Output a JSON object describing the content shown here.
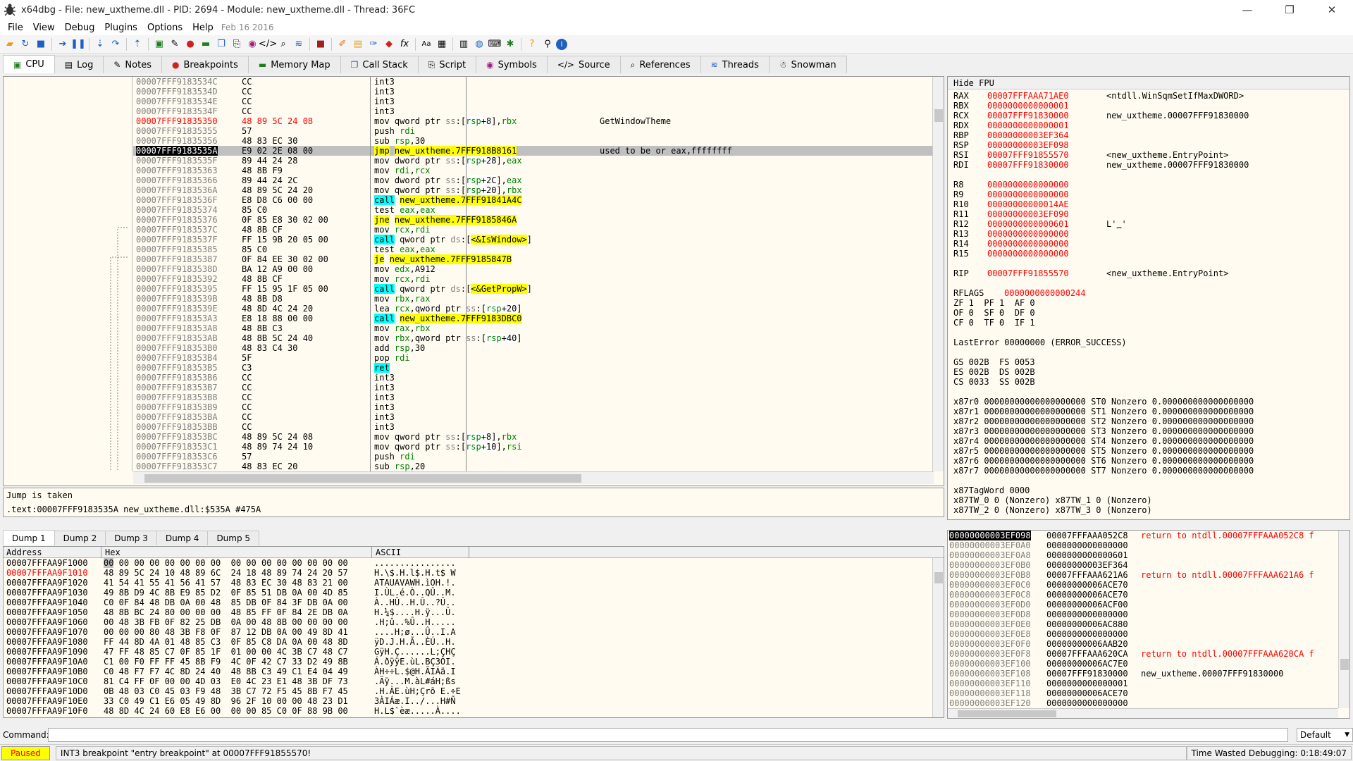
{
  "window": {
    "title": "x64dbg - File: new_uxtheme.dll - PID: 2694 - Module: new_uxtheme.dll - Thread: 36FC",
    "minimize": "—",
    "maximize": "❐",
    "close": "✕"
  },
  "menu": {
    "items": [
      "File",
      "View",
      "Debug",
      "Plugins",
      "Options",
      "Help"
    ],
    "date": "Feb 16 2016"
  },
  "tabs": [
    {
      "label": "CPU",
      "icon": "cpu-icon"
    },
    {
      "label": "Log",
      "icon": "log-icon"
    },
    {
      "label": "Notes",
      "icon": "notes-icon"
    },
    {
      "label": "Breakpoints",
      "icon": "breakpoint-dot-icon"
    },
    {
      "label": "Memory Map",
      "icon": "memory-map-icon"
    },
    {
      "label": "Call Stack",
      "icon": "call-stack-icon"
    },
    {
      "label": "Script",
      "icon": "script-icon"
    },
    {
      "label": "Symbols",
      "icon": "symbols-icon"
    },
    {
      "label": "Source",
      "icon": "source-icon"
    },
    {
      "label": "References",
      "icon": "references-icon"
    },
    {
      "label": "Threads",
      "icon": "threads-icon"
    },
    {
      "label": "Snowman",
      "icon": "snowman-icon"
    }
  ],
  "disasm": [
    {
      "addr": "00007FFF9183534C",
      "bytes": "CC",
      "instr": "int3",
      "cmt": ""
    },
    {
      "addr": "00007FFF9183534D",
      "bytes": "CC",
      "instr": "int3",
      "cmt": ""
    },
    {
      "addr": "00007FFF9183534E",
      "bytes": "CC",
      "instr": "int3",
      "cmt": ""
    },
    {
      "addr": "00007FFF9183534F",
      "bytes": "CC",
      "instr": "int3",
      "cmt": ""
    },
    {
      "addr": "00007FFF91835350",
      "bytes": "48 89 5C 24 08",
      "instr": "mov qword ptr ss:[rsp+8],rbx",
      "cmt": "GetWindowTheme",
      "bp": true
    },
    {
      "addr": "00007FFF91835355",
      "bytes": "57",
      "instr": "push rdi",
      "cmt": ""
    },
    {
      "addr": "00007FFF91835356",
      "bytes": "48 83 EC 30",
      "instr": "sub rsp,30",
      "cmt": ""
    },
    {
      "addr": "00007FFF9183535A",
      "bytes": "E9 02 2E 08 00",
      "instr": "jmp new_uxtheme.7FFF918B8161",
      "cmt": "used to be or eax,ffffffff",
      "cur": true,
      "hl": "jmp"
    },
    {
      "addr": "00007FFF9183535F",
      "bytes": "89 44 24 28",
      "instr": "mov dword ptr ss:[rsp+28],eax",
      "cmt": ""
    },
    {
      "addr": "00007FFF91835363",
      "bytes": "48 8B F9",
      "instr": "mov rdi,rcx",
      "cmt": ""
    },
    {
      "addr": "00007FFF91835366",
      "bytes": "89 44 24 2C",
      "instr": "mov dword ptr ss:[rsp+2C],eax",
      "cmt": ""
    },
    {
      "addr": "00007FFF9183536A",
      "bytes": "48 89 5C 24 20",
      "instr": "mov qword ptr ss:[rsp+20],rbx",
      "cmt": ""
    },
    {
      "addr": "00007FFF9183536F",
      "bytes": "E8 D8 C6 00 00",
      "instr": "call new_uxtheme.7FFF91841A4C",
      "cmt": "",
      "hl": "call"
    },
    {
      "addr": "00007FFF91835374",
      "bytes": "85 C0",
      "instr": "test eax,eax",
      "cmt": ""
    },
    {
      "addr": "00007FFF91835376",
      "bytes": "0F 85 E8 30 02 00",
      "instr": "jne new_uxtheme.7FFF9185846A",
      "cmt": "",
      "hl": "jmp"
    },
    {
      "addr": "00007FFF9183537C",
      "bytes": "48 8B CF",
      "instr": "mov rcx,rdi",
      "cmt": ""
    },
    {
      "addr": "00007FFF9183537F",
      "bytes": "FF 15 9B 20 05 00",
      "instr": "call qword ptr ds:[<&IsWindow>]",
      "cmt": "",
      "hl": "call"
    },
    {
      "addr": "00007FFF91835385",
      "bytes": "85 C0",
      "instr": "test eax,eax",
      "cmt": ""
    },
    {
      "addr": "00007FFF91835387",
      "bytes": "0F 84 EE 30 02 00",
      "instr": "je new_uxtheme.7FFF9185847B",
      "cmt": "",
      "hl": "jmp"
    },
    {
      "addr": "00007FFF9183538D",
      "bytes": "BA 12 A9 00 00",
      "instr": "mov edx,A912",
      "cmt": ""
    },
    {
      "addr": "00007FFF91835392",
      "bytes": "48 8B CF",
      "instr": "mov rcx,rdi",
      "cmt": ""
    },
    {
      "addr": "00007FFF91835395",
      "bytes": "FF 15 95 1F 05 00",
      "instr": "call qword ptr ds:[<&GetPropW>]",
      "cmt": "",
      "hl": "call"
    },
    {
      "addr": "00007FFF9183539B",
      "bytes": "48 8B D8",
      "instr": "mov rbx,rax",
      "cmt": ""
    },
    {
      "addr": "00007FFF9183539E",
      "bytes": "48 8D 4C 24 20",
      "instr": "lea rcx,qword ptr ss:[rsp+20]",
      "cmt": ""
    },
    {
      "addr": "00007FFF918353A3",
      "bytes": "E8 18 88 00 00",
      "instr": "call new_uxtheme.7FFF9183DBC0",
      "cmt": "",
      "hl": "call"
    },
    {
      "addr": "00007FFF918353A8",
      "bytes": "48 8B C3",
      "instr": "mov rax,rbx",
      "cmt": ""
    },
    {
      "addr": "00007FFF918353AB",
      "bytes": "48 8B 5C 24 40",
      "instr": "mov rbx,qword ptr ss:[rsp+40]",
      "cmt": ""
    },
    {
      "addr": "00007FFF918353B0",
      "bytes": "48 83 C4 30",
      "instr": "add rsp,30",
      "cmt": ""
    },
    {
      "addr": "00007FFF918353B4",
      "bytes": "5F",
      "instr": "pop rdi",
      "cmt": ""
    },
    {
      "addr": "00007FFF918353B5",
      "bytes": "C3",
      "instr": "ret",
      "cmt": "",
      "hl": "ret"
    },
    {
      "addr": "00007FFF918353B6",
      "bytes": "CC",
      "instr": "int3",
      "cmt": ""
    },
    {
      "addr": "00007FFF918353B7",
      "bytes": "CC",
      "instr": "int3",
      "cmt": ""
    },
    {
      "addr": "00007FFF918353B8",
      "bytes": "CC",
      "instr": "int3",
      "cmt": ""
    },
    {
      "addr": "00007FFF918353B9",
      "bytes": "CC",
      "instr": "int3",
      "cmt": ""
    },
    {
      "addr": "00007FFF918353BA",
      "bytes": "CC",
      "instr": "int3",
      "cmt": ""
    },
    {
      "addr": "00007FFF918353BB",
      "bytes": "CC",
      "instr": "int3",
      "cmt": ""
    },
    {
      "addr": "00007FFF918353BC",
      "bytes": "48 89 5C 24 08",
      "instr": "mov qword ptr ss:[rsp+8],rbx",
      "cmt": ""
    },
    {
      "addr": "00007FFF918353C1",
      "bytes": "48 89 74 24 10",
      "instr": "mov qword ptr ss:[rsp+10],rsi",
      "cmt": ""
    },
    {
      "addr": "00007FFF918353C6",
      "bytes": "57",
      "instr": "push rdi",
      "cmt": ""
    },
    {
      "addr": "00007FFF918353C7",
      "bytes": "48 83 EC 20",
      "instr": "sub rsp,20",
      "cmt": ""
    }
  ],
  "info": {
    "line1": "Jump is taken",
    "line2": ".text:00007FFF9183535A new_uxtheme.dll:$535A #475A"
  },
  "regs": {
    "hide_fpu": "Hide FPU",
    "rows": [
      {
        "n": "RAX",
        "v": "00007FFFAAA71AE0",
        "c": "<ntdll.WinSqmSetIfMaxDWORD>"
      },
      {
        "n": "RBX",
        "v": "0000000000000001",
        "c": ""
      },
      {
        "n": "RCX",
        "v": "00007FFF91830000",
        "c": "new_uxtheme.00007FFF91830000"
      },
      {
        "n": "RDX",
        "v": "0000000000000001",
        "c": ""
      },
      {
        "n": "RBP",
        "v": "00000000003EF364",
        "c": ""
      },
      {
        "n": "RSP",
        "v": "00000000003EF098",
        "c": ""
      },
      {
        "n": "RSI",
        "v": "00007FFF91855570",
        "c": "<new_uxtheme.EntryPoint>"
      },
      {
        "n": "RDI",
        "v": "00007FFF91830000",
        "c": "new_uxtheme.00007FFF91830000"
      },
      {
        "n": "",
        "v": "",
        "c": ""
      },
      {
        "n": "R8",
        "v": "0000000000000000",
        "c": ""
      },
      {
        "n": "R9",
        "v": "0000000000000000",
        "c": ""
      },
      {
        "n": "R10",
        "v": "00000000000014AE",
        "c": ""
      },
      {
        "n": "R11",
        "v": "00000000003EF090",
        "c": ""
      },
      {
        "n": "R12",
        "v": "0000000000000601",
        "c": "L'؁'"
      },
      {
        "n": "R13",
        "v": "0000000000000000",
        "c": ""
      },
      {
        "n": "R14",
        "v": "0000000000000000",
        "c": ""
      },
      {
        "n": "R15",
        "v": "0000000000000000",
        "c": ""
      },
      {
        "n": "",
        "v": "",
        "c": ""
      },
      {
        "n": "RIP",
        "v": "00007FFF91855570",
        "c": "<new_uxtheme.EntryPoint>"
      },
      {
        "n": "",
        "v": "",
        "c": ""
      },
      {
        "n": "RFLAGS",
        "v": "0000000000000244",
        "c": ""
      }
    ],
    "flags": [
      "ZF 1  PF 1  AF 0",
      "OF 0  SF 0  DF 0",
      "CF 0  TF 0  IF 1"
    ],
    "lasterror": "LastError 00000000 (ERROR_SUCCESS)",
    "segs": [
      "GS 002B  FS 0053",
      "ES 002B  DS 002B",
      "CS 0033  SS 002B"
    ],
    "fpu": [
      "x87r0 00000000000000000000 ST0 Nonzero 0.000000000000000000",
      "x87r1 00000000000000000000 ST1 Nonzero 0.000000000000000000",
      "x87r2 00000000000000000000 ST2 Nonzero 0.000000000000000000",
      "x87r3 00000000000000000000 ST3 Nonzero 0.000000000000000000",
      "x87r4 00000000000000000000 ST4 Nonzero 0.000000000000000000",
      "x87r5 00000000000000000000 ST5 Nonzero 0.000000000000000000",
      "x87r6 00000000000000000000 ST6 Nonzero 0.000000000000000000",
      "x87r7 00000000000000000000 ST7 Nonzero 0.000000000000000000"
    ],
    "tag": [
      "x87TagWord 0000",
      "x87TW_0 0 (Nonzero) x87TW_1 0 (Nonzero)",
      "x87TW_2 0 (Nonzero) x87TW_3 0 (Nonzero)"
    ]
  },
  "dumptabs": [
    "Dump 1",
    "Dump 2",
    "Dump 3",
    "Dump 4",
    "Dump 5"
  ],
  "dump": {
    "headers": {
      "addr": "Address",
      "hex": "Hex",
      "ascii": "ASCII"
    },
    "rows": [
      {
        "a": "00007FFFAA9F1000",
        "h": "00 00 00 00 00 00 00 00  00 00 00 00 00 00 00 00",
        "s": "................"
      },
      {
        "a": "00007FFFAA9F1010",
        "h": "48 89 5C 24 10 48 89 6C  24 18 48 89 74 24 20 57",
        "s": "H.\\$.H.l$.H.t$ W",
        "red": true
      },
      {
        "a": "00007FFFAA9F1020",
        "h": "41 54 41 55 41 56 41 57  48 83 EC 30 48 83 21 00",
        "s": "ATAUAVAWH.ìOH.!."
      },
      {
        "a": "00007FFFAA9F1030",
        "h": "49 8B D9 4C 8B E9 85 D2  0F 85 51 DB 0A 00 4D 85",
        "s": "I.ÙL.é.Ò..QÛ..M."
      },
      {
        "a": "00007FFFAA9F1040",
        "h": "C0 0F 84 48 DB 0A 00 48  85 DB 0F 84 3F DB 0A 00",
        "s": "À..HÛ..H.Û..?Û.."
      },
      {
        "a": "00007FFFAA9F1050",
        "h": "48 8B BC 24 80 00 00 00  48 85 FF 0F 84 2E DB 0A",
        "s": "H.¼$....H.ÿ...Û."
      },
      {
        "a": "00007FFFAA9F1060",
        "h": "00 48 3B FB 0F 82 25 DB  0A 00 48 8B 00 00 00 00",
        "s": ".H;û..%Û..H....."
      },
      {
        "a": "00007FFFAA9F1070",
        "h": "00 00 00 80 48 3B F8 0F  87 12 DB 0A 00 49 8D 41",
        "s": "....H;ø...Û..I.A"
      },
      {
        "a": "00007FFFAA9F1080",
        "h": "FF 44 8D 4A 01 48 85 C3  0F 85 C8 DA 0A 00 48 8D",
        "s": "ÿD.J.H.Ã..ÈÚ..H."
      },
      {
        "a": "00007FFFAA9F1090",
        "h": "47 FF 48 85 C7 0F 85 1F  01 00 00 4C 3B C7 48 C7",
        "s": "GÿH.Ç......L;ÇHÇ"
      },
      {
        "a": "00007FFFAA9F10A0",
        "h": "C1 00 F0 FF FF 45 8B F9  4C 0F 42 C7 33 D2 49 8B",
        "s": "Á.ðÿÿE.ùL.BÇ3ÒI."
      },
      {
        "a": "00007FFFAA9F10B0",
        "h": "C0 48 F7 F7 4C 8D 24 40  48 8B C3 49 C1 E4 04 49",
        "s": "ÀH÷÷L.$@H.ÃIÁä.I"
      },
      {
        "a": "00007FFFAA9F10C0",
        "h": "81 C4 FF 0F 00 00 4D 03  E0 4C 23 E1 48 3B DF 73",
        "s": ".Äÿ...M.àL#áH;ßs"
      },
      {
        "a": "00007FFFAA9F10D0",
        "h": "0B 48 03 C0 45 03 F9 48  3B C7 72 F5 45 8B F7 45",
        "s": ".H.ÀE.ùH;Çrõ E.÷E"
      },
      {
        "a": "00007FFFAA9F10E0",
        "h": "33 C0 49 C1 E6 05 49 8D  96 2F 10 00 00 48 23 D1",
        "s": "3ÀIÁæ.I../...H#Ñ"
      },
      {
        "a": "00007FFFAA9F10F0",
        "h": "48 8D 4C 24 60 E8 E6 00  00 00 85 C0 0F 88 9B 00",
        "s": "H.L$`èæ.....À...."
      }
    ]
  },
  "stack": [
    {
      "a": "00000000003EF098",
      "v": "00007FFFAAA052C8",
      "c": "return to ntdll.00007FFFAAA052C8 f",
      "ret": true,
      "top": true
    },
    {
      "a": "00000000003EF0A0",
      "v": "0000000000000000",
      "c": ""
    },
    {
      "a": "00000000003EF0A8",
      "v": "0000000000000601",
      "c": ""
    },
    {
      "a": "00000000003EF0B0",
      "v": "00000000003EF364",
      "c": ""
    },
    {
      "a": "00000000003EF0B8",
      "v": "00007FFFAAA621A6",
      "c": "return to ntdll.00007FFFAAA621A6 f",
      "ret": true
    },
    {
      "a": "00000000003EF0C0",
      "v": "00000000006ACE70",
      "c": ""
    },
    {
      "a": "00000000003EF0C8",
      "v": "00000000006ACE70",
      "c": ""
    },
    {
      "a": "00000000003EF0D0",
      "v": "00000000006ACF00",
      "c": ""
    },
    {
      "a": "00000000003EF0D8",
      "v": "0000000000000000",
      "c": ""
    },
    {
      "a": "00000000003EF0E0",
      "v": "00000000006AC880",
      "c": ""
    },
    {
      "a": "00000000003EF0E8",
      "v": "0000000000000000",
      "c": ""
    },
    {
      "a": "00000000003EF0F0",
      "v": "00000000006AAB20",
      "c": ""
    },
    {
      "a": "00000000003EF0F8",
      "v": "00007FFFAAA620CA",
      "c": "return to ntdll.00007FFFAAA620CA f",
      "ret": true
    },
    {
      "a": "00000000003EF100",
      "v": "00000000006AC7E0",
      "c": ""
    },
    {
      "a": "00000000003EF108",
      "v": "00007FFF91830000",
      "c": "new_uxtheme.00007FFF91830000"
    },
    {
      "a": "00000000003EF110",
      "v": "0000000000000001",
      "c": ""
    },
    {
      "a": "00000000003EF118",
      "v": "00000000006ACE70",
      "c": ""
    },
    {
      "a": "00000000003EF120",
      "v": "0000000000000000",
      "c": ""
    }
  ],
  "cmd": {
    "label": "Command:",
    "value": "",
    "mode": "Default"
  },
  "status": {
    "state": "Paused",
    "msg": "INT3 breakpoint \"entry breakpoint\" at 00007FFF91855570!",
    "time": "Time Wasted Debugging: 0:18:49:07"
  }
}
